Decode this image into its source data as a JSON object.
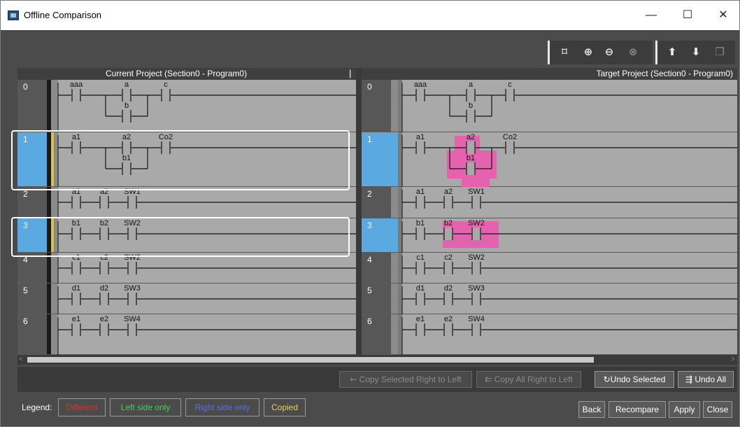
{
  "window": {
    "title": "Offline Comparison",
    "minimize": "—",
    "maximize": "☐",
    "close": "✕"
  },
  "toolbar": {
    "fit": "⌑",
    "zoom_in": "⊕",
    "zoom_out": "⊖",
    "zoom_100": "⊗",
    "up": "⬆",
    "down": "⬇",
    "copy": "❐"
  },
  "left_pane": {
    "header": "Current Project (Section0 - Program0)",
    "rungs": [
      {
        "num": "0",
        "labels": [
          "aaa",
          "a",
          "c",
          "b"
        ]
      },
      {
        "num": "1",
        "labels": [
          "a1",
          "a2",
          "Co2",
          "b1"
        ]
      },
      {
        "num": "2",
        "labels": [
          "a1",
          "a2",
          "SW1"
        ]
      },
      {
        "num": "3",
        "labels": [
          "b1",
          "b2",
          "SW2"
        ]
      },
      {
        "num": "4",
        "labels": [
          "c1",
          "c2",
          "SW2"
        ]
      },
      {
        "num": "5",
        "labels": [
          "d1",
          "d2",
          "SW3"
        ]
      },
      {
        "num": "6",
        "labels": [
          "e1",
          "e2",
          "SW4"
        ]
      }
    ]
  },
  "right_pane": {
    "header": "Target Project (Section0 - Program0)",
    "rungs": [
      {
        "num": "0",
        "labels": [
          "aaa",
          "a",
          "c",
          "b"
        ]
      },
      {
        "num": "1",
        "labels": [
          "a1",
          "a2",
          "Co2",
          "b1"
        ]
      },
      {
        "num": "2",
        "labels": [
          "a1",
          "a2",
          "SW1"
        ]
      },
      {
        "num": "3",
        "labels": [
          "b1",
          "b2",
          "SW2"
        ]
      },
      {
        "num": "4",
        "labels": [
          "c1",
          "c2",
          "SW2"
        ]
      },
      {
        "num": "5",
        "labels": [
          "d1",
          "d2",
          "SW3"
        ]
      },
      {
        "num": "6",
        "labels": [
          "e1",
          "e2",
          "SW4"
        ]
      }
    ]
  },
  "actions": {
    "copy_selected": "Copy Selected Right to Left",
    "copy_all": "Copy All Right to Left",
    "undo_selected": "Undo Selected",
    "undo_all": "Undo All"
  },
  "legend": {
    "label": "Legend:",
    "different": "Different",
    "left_only": "Left side only",
    "right_only": "Right side only",
    "copied": "Copied",
    "colors": {
      "different": "#e0302e",
      "left_only": "#45d255",
      "right_only": "#5b6ee8",
      "copied": "#e8d24a",
      "diff_highlight": "#e85fae",
      "selected": "#5aa9e0"
    }
  },
  "buttons": {
    "back": "Back",
    "recompare": "Recompare",
    "apply": "Apply",
    "close": "Close"
  }
}
